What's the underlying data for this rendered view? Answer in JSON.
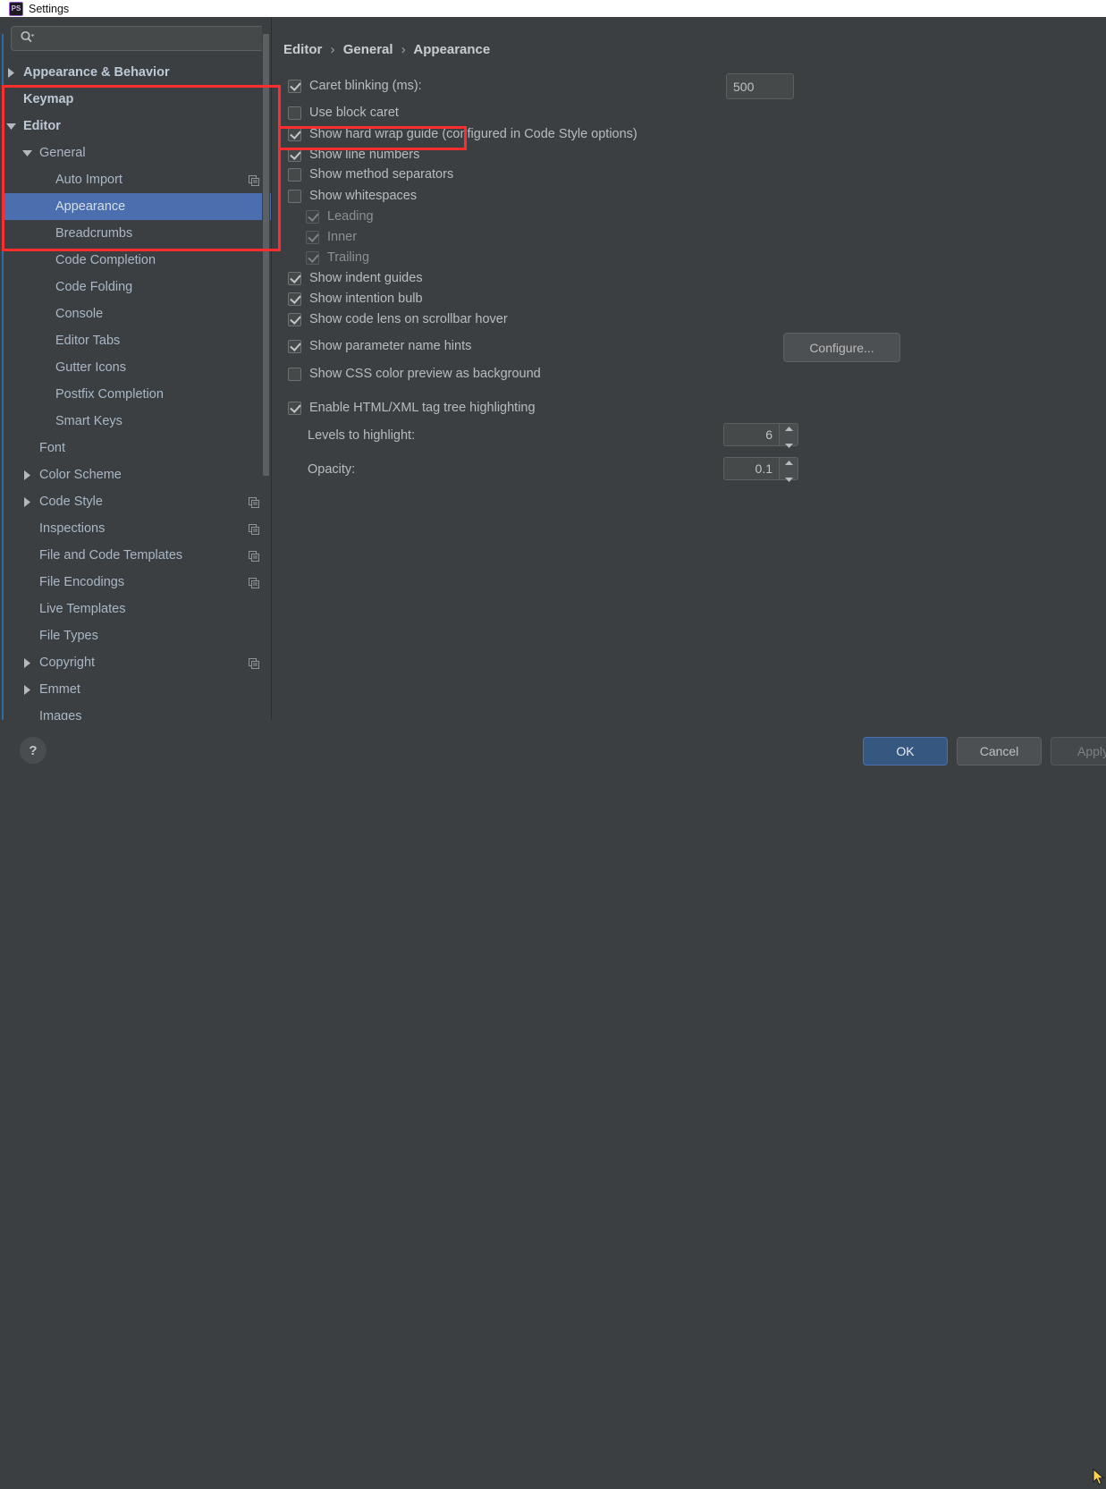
{
  "window": {
    "title": "Settings",
    "app_icon": "phpstorm-icon",
    "icon_text": "PS"
  },
  "search": {
    "placeholder": "",
    "value": "",
    "icon": "search-icon"
  },
  "sidebar": {
    "items": [
      {
        "label": "Appearance & Behavior",
        "indent": 0,
        "arrow": "right",
        "bold": true,
        "copy": false,
        "selected": false
      },
      {
        "label": "Keymap",
        "indent": 0,
        "arrow": "none",
        "bold": true,
        "copy": false,
        "selected": false
      },
      {
        "label": "Editor",
        "indent": 0,
        "arrow": "down",
        "bold": true,
        "copy": false,
        "selected": false
      },
      {
        "label": "General",
        "indent": 1,
        "arrow": "down",
        "bold": false,
        "copy": false,
        "selected": false
      },
      {
        "label": "Auto Import",
        "indent": 2,
        "arrow": "none",
        "bold": false,
        "copy": true,
        "selected": false
      },
      {
        "label": "Appearance",
        "indent": 2,
        "arrow": "none",
        "bold": false,
        "copy": false,
        "selected": true
      },
      {
        "label": "Breadcrumbs",
        "indent": 2,
        "arrow": "none",
        "bold": false,
        "copy": false,
        "selected": false
      },
      {
        "label": "Code Completion",
        "indent": 2,
        "arrow": "none",
        "bold": false,
        "copy": false,
        "selected": false
      },
      {
        "label": "Code Folding",
        "indent": 2,
        "arrow": "none",
        "bold": false,
        "copy": false,
        "selected": false
      },
      {
        "label": "Console",
        "indent": 2,
        "arrow": "none",
        "bold": false,
        "copy": false,
        "selected": false
      },
      {
        "label": "Editor Tabs",
        "indent": 2,
        "arrow": "none",
        "bold": false,
        "copy": false,
        "selected": false
      },
      {
        "label": "Gutter Icons",
        "indent": 2,
        "arrow": "none",
        "bold": false,
        "copy": false,
        "selected": false
      },
      {
        "label": "Postfix Completion",
        "indent": 2,
        "arrow": "none",
        "bold": false,
        "copy": false,
        "selected": false
      },
      {
        "label": "Smart Keys",
        "indent": 2,
        "arrow": "none",
        "bold": false,
        "copy": false,
        "selected": false
      },
      {
        "label": "Font",
        "indent": 1,
        "arrow": "none",
        "bold": false,
        "copy": false,
        "selected": false
      },
      {
        "label": "Color Scheme",
        "indent": 1,
        "arrow": "right",
        "bold": false,
        "copy": false,
        "selected": false
      },
      {
        "label": "Code Style",
        "indent": 1,
        "arrow": "right",
        "bold": false,
        "copy": true,
        "selected": false
      },
      {
        "label": "Inspections",
        "indent": 1,
        "arrow": "none",
        "bold": false,
        "copy": true,
        "selected": false
      },
      {
        "label": "File and Code Templates",
        "indent": 1,
        "arrow": "none",
        "bold": false,
        "copy": true,
        "selected": false
      },
      {
        "label": "File Encodings",
        "indent": 1,
        "arrow": "none",
        "bold": false,
        "copy": true,
        "selected": false
      },
      {
        "label": "Live Templates",
        "indent": 1,
        "arrow": "none",
        "bold": false,
        "copy": false,
        "selected": false
      },
      {
        "label": "File Types",
        "indent": 1,
        "arrow": "none",
        "bold": false,
        "copy": false,
        "selected": false
      },
      {
        "label": "Copyright",
        "indent": 1,
        "arrow": "right",
        "bold": false,
        "copy": true,
        "selected": false
      },
      {
        "label": "Emmet",
        "indent": 1,
        "arrow": "right",
        "bold": false,
        "copy": false,
        "selected": false
      },
      {
        "label": "Images",
        "indent": 1,
        "arrow": "none",
        "bold": false,
        "copy": false,
        "selected": false
      }
    ]
  },
  "breadcrumb": {
    "part1": "Editor",
    "part2": "General",
    "part3": "Appearance",
    "separator": "›"
  },
  "options": {
    "caret_blinking": {
      "label": "Caret blinking (ms):",
      "checked": true,
      "value": "500"
    },
    "use_block_caret": {
      "label": "Use block caret",
      "checked": false
    },
    "show_hard_wrap_guide": {
      "label": "Show hard wrap guide (configured in Code Style options)",
      "checked": true
    },
    "show_line_numbers": {
      "label": "Show line numbers",
      "checked": true
    },
    "show_method_separators": {
      "label": "Show method separators",
      "checked": false
    },
    "show_whitespaces": {
      "label": "Show whitespaces",
      "checked": false
    },
    "leading": {
      "label": "Leading",
      "checked": true,
      "disabled": true
    },
    "inner": {
      "label": "Inner",
      "checked": true,
      "disabled": true
    },
    "trailing": {
      "label": "Trailing",
      "checked": true,
      "disabled": true
    },
    "show_indent_guides": {
      "label": "Show indent guides",
      "checked": true
    },
    "show_intention_bulb": {
      "label": "Show intention bulb",
      "checked": true
    },
    "show_code_lens": {
      "label": "Show code lens on scrollbar hover",
      "checked": true
    },
    "show_parameter_name_hints": {
      "label": "Show parameter name hints",
      "checked": true
    },
    "configure_button": "Configure...",
    "show_css_color_preview": {
      "label": "Show CSS color preview as background",
      "checked": false
    },
    "enable_tag_tree_highlighting": {
      "label": "Enable HTML/XML tag tree highlighting",
      "checked": true
    },
    "levels_to_highlight": {
      "label": "Levels to highlight:",
      "value": "6"
    },
    "opacity": {
      "label": "Opacity:",
      "value": "0.1"
    }
  },
  "footer": {
    "help_label": "?",
    "ok_label": "OK",
    "cancel_label": "Cancel",
    "apply_label": "Apply"
  },
  "annotations": {
    "colors": {
      "highlight": "#ff2d2d",
      "accent": "#4b6eaf",
      "ok_button": "#365880"
    },
    "boxes": [
      {
        "name": "sidebar-tree-highlight"
      },
      {
        "name": "show-line-numbers-highlight"
      }
    ]
  }
}
